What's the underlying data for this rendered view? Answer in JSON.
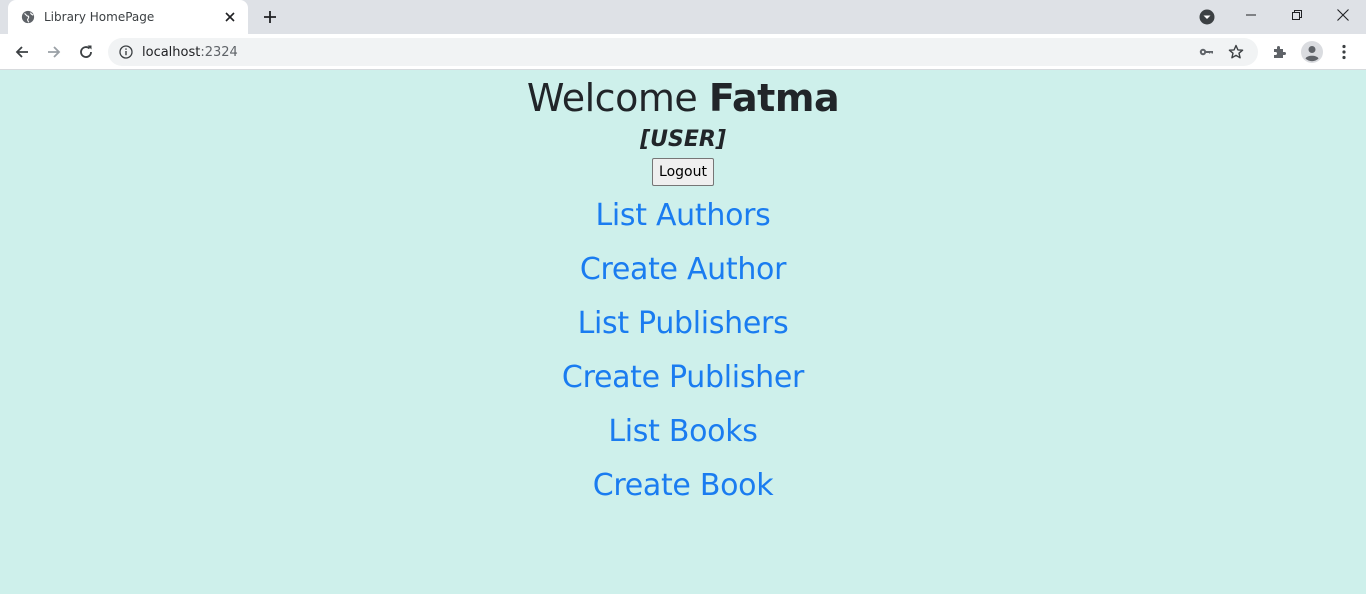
{
  "browser": {
    "tab_title": "Library HomePage",
    "url_host": "localhost",
    "url_port": ":2324",
    "icons": {
      "favicon": "globe-icon",
      "tab_close": "close-icon",
      "new_tab": "plus-icon",
      "tab_search": "chevron-down-circle-icon",
      "back": "arrow-left-icon",
      "forward": "arrow-right-icon",
      "reload": "reload-icon",
      "site_info": "info-icon",
      "password": "key-icon",
      "bookmark": "star-icon",
      "extensions": "puzzle-icon",
      "profile": "avatar-icon",
      "menu": "kebab-menu-icon"
    }
  },
  "page": {
    "welcome_prefix": "Welcome",
    "user_name": "Fatma",
    "role": "[USER]",
    "logout_label": "Logout",
    "links": [
      {
        "label": "List Authors"
      },
      {
        "label": "Create Author"
      },
      {
        "label": "List Publishers"
      },
      {
        "label": "Create Publisher"
      },
      {
        "label": "List Books"
      },
      {
        "label": "Create Book"
      }
    ]
  },
  "colors": {
    "page_background": "#cef0eb",
    "link": "#1a7cf0",
    "heading_text": "#212529"
  }
}
